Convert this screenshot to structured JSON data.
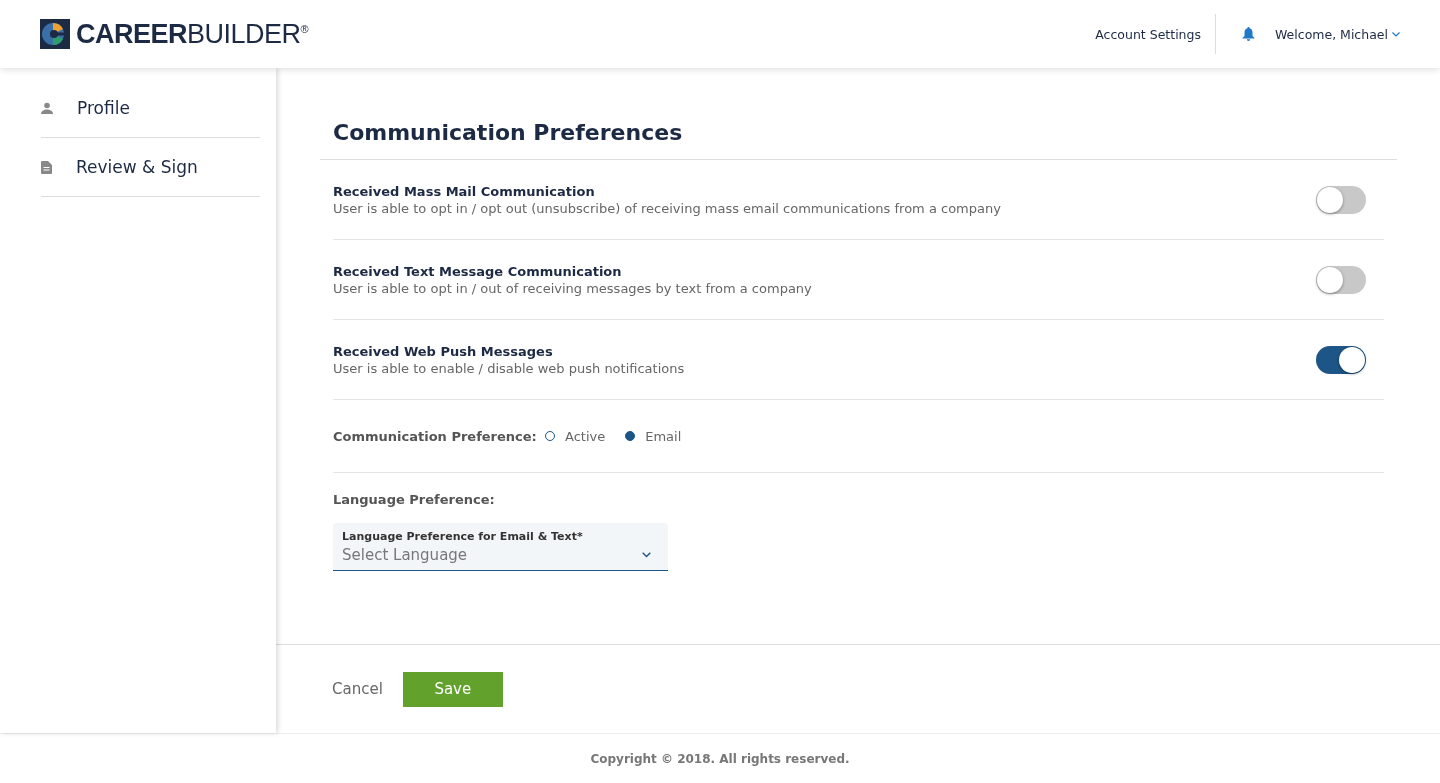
{
  "header": {
    "logo": "**CAREER**BUILDER$^{®}$",
    "account_settings": "Account Settings",
    "welcome": "Welcome, Michael"
  },
  "sidebar": {
    "items": [
      {
        "label": "Profile",
        "kind": "person",
        "selected": false
      },
      {
        "label": "Review & Sign",
        "kind": "document",
        "selected": false
      }
    ]
  },
  "page": {
    "title": "Communication Preferences",
    "settings": [
      {
        "title": "Received Mass Mail Communication",
        "description": "User is able to opt in / opt out (unsubscribe) of receiving mass email communications from a company",
        "on": false
      },
      {
        "title": "Received Text Message Communication",
        "description": "User is able to opt in / out of receiving messages by text from a company",
        "on": false
      },
      {
        "title": "Received Web Push Messages",
        "description": "User is able to enable / disable web push notifications",
        "on": true
      }
    ],
    "communication_preference": {
      "label": "Communication Preference:",
      "options": [
        {
          "label": "Active",
          "selected": false
        },
        {
          "label": "Email",
          "selected": true
        }
      ]
    },
    "language_preference": {
      "label": "Language Preference:",
      "field_label": "Language Preference for Email & Text*",
      "placeholder": "Select Language"
    }
  },
  "actions": {
    "cancel": "Cancel",
    "save": "Save"
  },
  "footer": {
    "copyright": "Copyright © 2018. All rights reserved."
  }
}
